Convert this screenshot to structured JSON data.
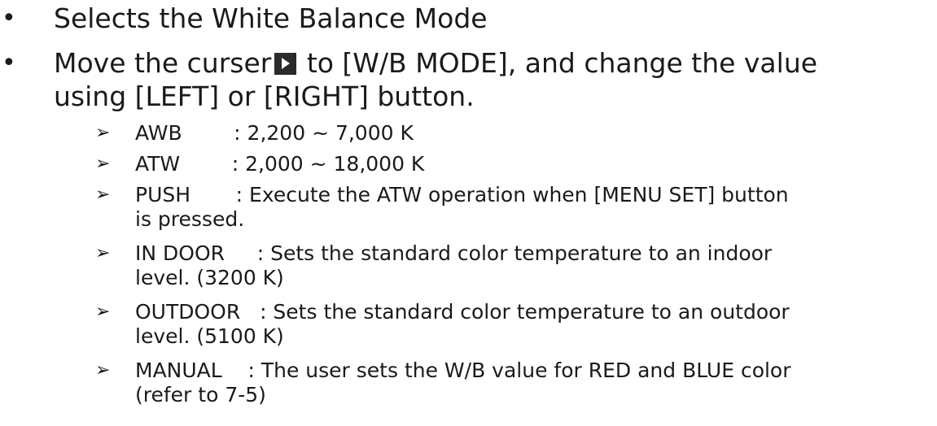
{
  "bullets": [
    {
      "text": "Selects the White Balance Mode"
    },
    {
      "text_before_icon": "Move the curser",
      "icon": "cursor-arrow-icon",
      "text_after_icon": " to [W/B MODE], and change the value",
      "text_line2": "using [LEFT] or [RIGHT] button."
    }
  ],
  "modes": [
    {
      "label": "AWB        : 2,200 ~ 7,000 K"
    },
    {
      "label": "ATW        : 2,000 ~ 18,000 K"
    },
    {
      "label": "PUSH       : Execute the ATW operation when [MENU SET] button",
      "cont": "is pressed."
    },
    {
      "label": "IN DOOR     : Sets the standard color temperature to an indoor",
      "cont": "level.  (3200 K)"
    },
    {
      "label": "OUTDOOR   : Sets the standard color temperature to an outdoor",
      "cont": "level.  (5100 K)"
    },
    {
      "label": "MANUAL    : The user sets the W/B value for RED and BLUE color",
      "cont": "(refer to 7-5)"
    }
  ],
  "bullet_symbol": "•",
  "arrow_symbol": "➢"
}
